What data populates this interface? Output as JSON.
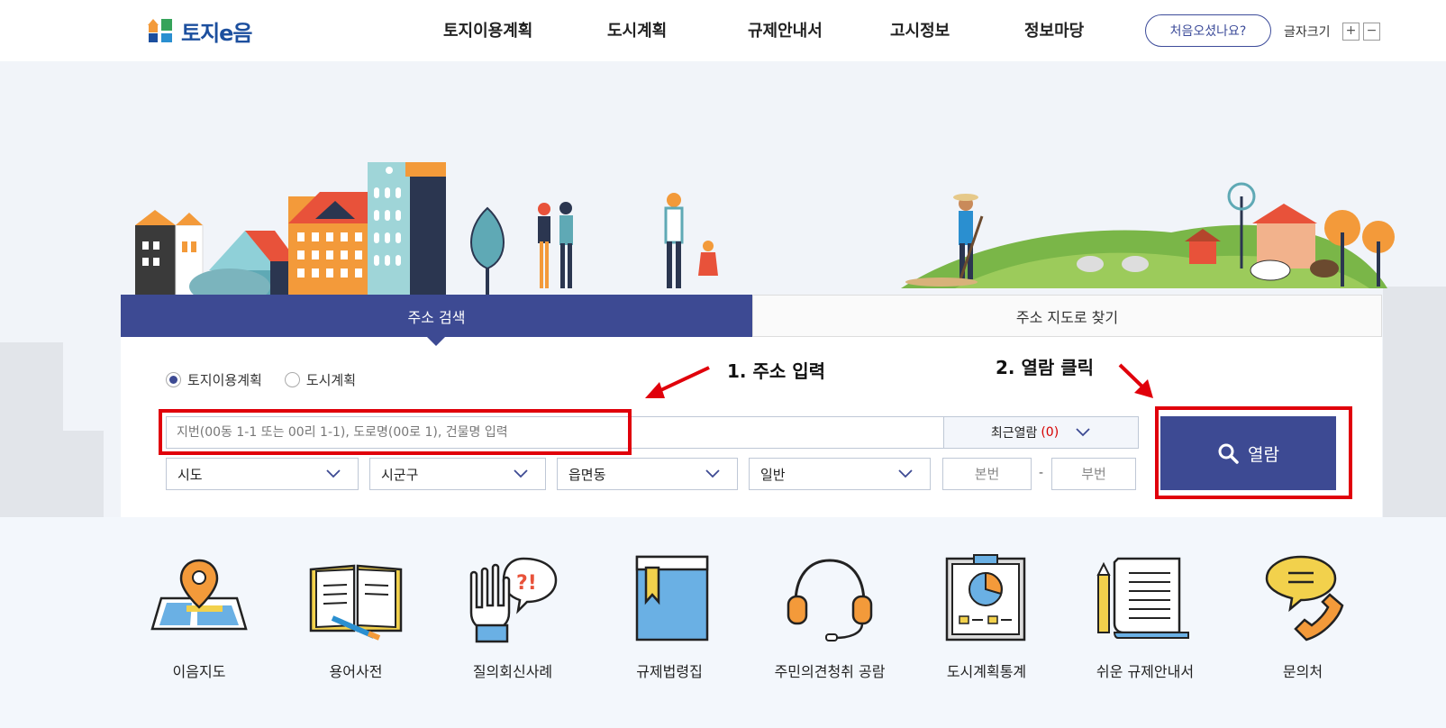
{
  "header": {
    "logo_text": "토지e음",
    "nav": [
      "토지이용계획",
      "도시계획",
      "규제안내서",
      "고시정보",
      "정보마당"
    ],
    "first_visit": "처음오셨나요?",
    "font_size_label": "글자크기",
    "font_plus": "+",
    "font_minus": "−"
  },
  "tabs": {
    "address_search": "주소 검색",
    "map_search": "주소 지도로 찾기"
  },
  "search": {
    "radio_land": "토지이용계획",
    "radio_city": "도시계획",
    "selected_radio": "토지이용계획",
    "address_placeholder": "지번(00동 1-1 또는 00리 1-1), 도로명(00로 1), 건물명 입력",
    "recent_label": "최근열람",
    "recent_count": "(0)",
    "sido": "시도",
    "sigungu": "시군구",
    "eupmyeondong": "읍면동",
    "land_type": "일반",
    "main_no_placeholder": "본번",
    "dash": "-",
    "sub_no_placeholder": "부번",
    "view_button": "열람"
  },
  "annotations": {
    "step1": "1. 주소 입력",
    "step2": "2. 열람 클릭",
    "color": "#e0000b"
  },
  "quick_menu": [
    {
      "label": "이음지도",
      "icon": "map-pin-icon"
    },
    {
      "label": "용어사전",
      "icon": "open-book-icon"
    },
    {
      "label": "질의회신사례",
      "icon": "question-hand-icon"
    },
    {
      "label": "규제법령집",
      "icon": "law-book-icon"
    },
    {
      "label": "주민의견청취 공람",
      "icon": "headset-icon"
    },
    {
      "label": "도시계획통계",
      "icon": "chart-board-icon"
    },
    {
      "label": "쉬운 규제안내서",
      "icon": "document-pencil-icon"
    },
    {
      "label": "문의처",
      "icon": "phone-chat-icon"
    }
  ],
  "colors": {
    "primary": "#3d4a93",
    "accent_red": "#e0000b",
    "orange": "#f39a3a"
  }
}
